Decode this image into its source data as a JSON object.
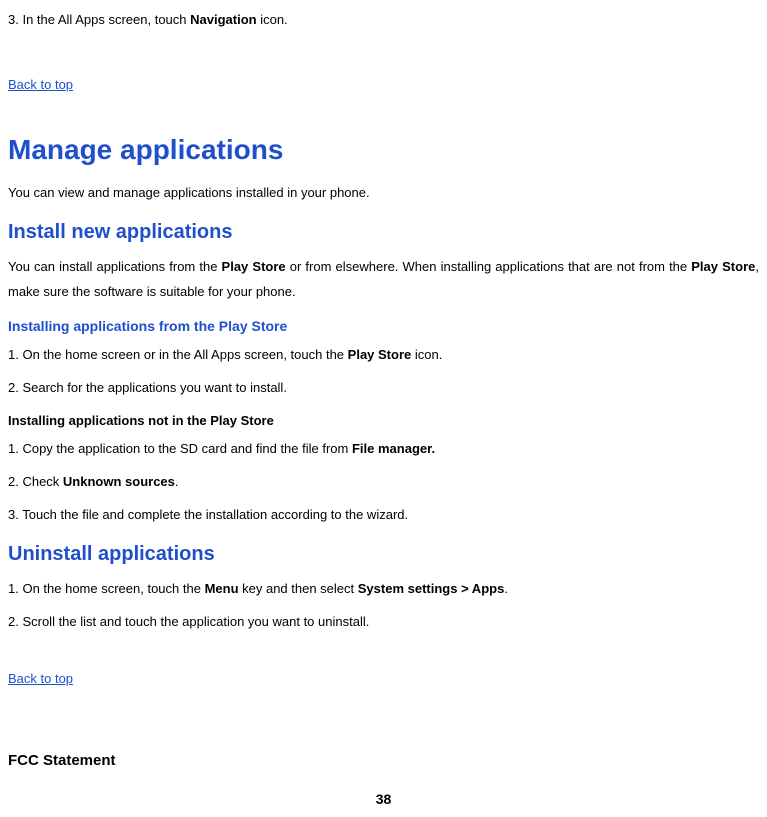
{
  "step3": {
    "prefix": "3. In the All Apps screen, touch ",
    "bold": "Navigation",
    "suffix": " icon."
  },
  "back_to_top_1": "Back to top",
  "h1_manage": "Manage applications",
  "manage_intro": "You can view and manage applications installed in your phone.",
  "h2_install": "Install new applications",
  "install_intro": {
    "p1": "You can install applications from the ",
    "b1": "Play Store",
    "p2": " or from elsewhere. When installing applications that are not from the ",
    "b2": "Play Store",
    "p3": ", make sure the software is suitable for your phone."
  },
  "h3_from_store": "Installing applications from the Play Store",
  "from_store_1": {
    "prefix": "1. On the home screen or in the All Apps screen, touch the ",
    "bold": "Play Store",
    "suffix": " icon."
  },
  "from_store_2": "2. Search for the applications you want to install.",
  "h4_not_store": "Installing applications not in the Play Store",
  "not_store_1": {
    "prefix": "1. Copy the application to the SD card and find the file from ",
    "bold": "File manager."
  },
  "not_store_2": {
    "prefix": "2. Check ",
    "bold": "Unknown sources",
    "suffix": "."
  },
  "not_store_3": "3. Touch the file and complete the installation according to the wizard.",
  "h2_uninstall": "Uninstall applications",
  "uninstall_1": {
    "prefix": "1. On the home screen, touch the ",
    "bold1": "Menu",
    "mid": " key and then select ",
    "bold2": "System settings > Apps",
    "suffix": "."
  },
  "uninstall_2": "2. Scroll the list and touch the application you want to uninstall.",
  "back_to_top_2": "Back to top",
  "fcc": "FCC Statement",
  "page_number": "38"
}
